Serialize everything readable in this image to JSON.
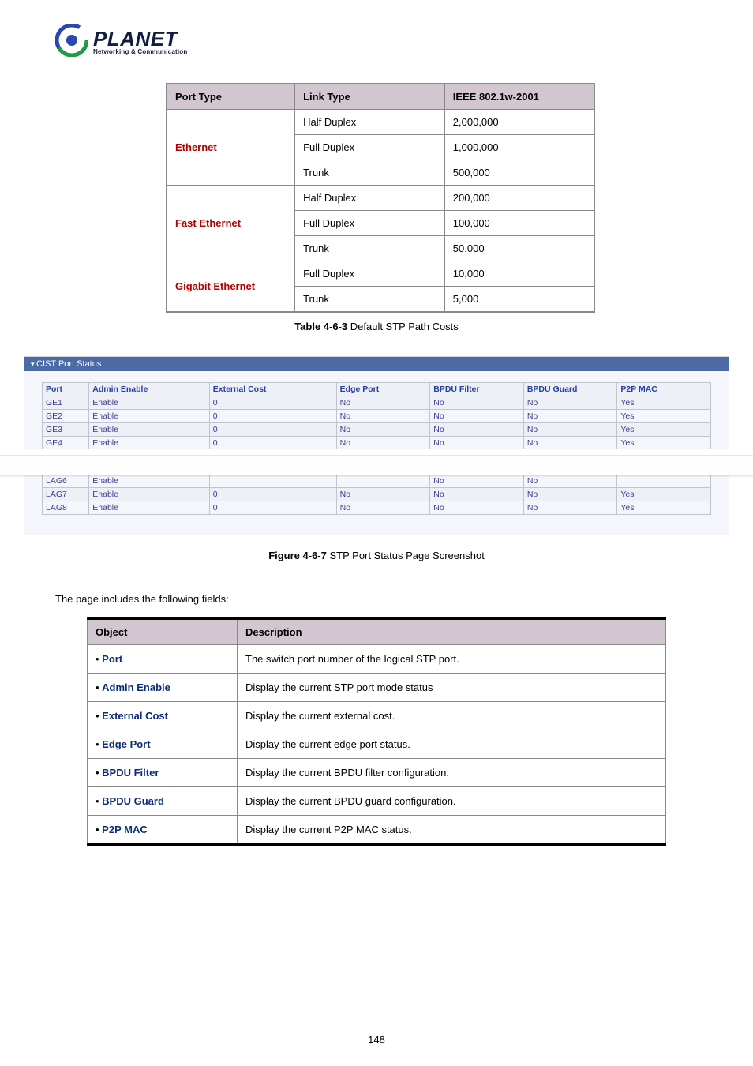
{
  "logo": {
    "brand": "PLANET",
    "tagline": "Networking & Communication"
  },
  "pathCost": {
    "headers": [
      "Port Type",
      "Link Type",
      "IEEE 802.1w-2001"
    ],
    "groups": [
      {
        "name": "Ethernet",
        "rows": [
          {
            "link": "Half Duplex",
            "cost": "2,000,000"
          },
          {
            "link": "Full Duplex",
            "cost": "1,000,000"
          },
          {
            "link": "Trunk",
            "cost": "500,000"
          }
        ]
      },
      {
        "name": "Fast Ethernet",
        "rows": [
          {
            "link": "Half Duplex",
            "cost": "200,000"
          },
          {
            "link": "Full Duplex",
            "cost": "100,000"
          },
          {
            "link": "Trunk",
            "cost": "50,000"
          }
        ]
      },
      {
        "name": "Gigabit Ethernet",
        "rows": [
          {
            "link": "Full Duplex",
            "cost": "10,000"
          },
          {
            "link": "Trunk",
            "cost": "5,000"
          }
        ]
      }
    ],
    "caption_bold": "Table 4-6-3",
    "caption_rest": " Default STP Path Costs"
  },
  "cist": {
    "title": "CIST Port Status",
    "headers": [
      "Port",
      "Admin Enable",
      "External Cost",
      "Edge Port",
      "BPDU Filter",
      "BPDU Guard",
      "P2P MAC"
    ],
    "top_rows": [
      {
        "c": [
          "GE1",
          "Enable",
          "0",
          "No",
          "No",
          "No",
          "Yes"
        ]
      },
      {
        "c": [
          "GE2",
          "Enable",
          "0",
          "No",
          "No",
          "No",
          "Yes"
        ]
      },
      {
        "c": [
          "GE3",
          "Enable",
          "0",
          "No",
          "No",
          "No",
          "Yes"
        ]
      },
      {
        "c": [
          "GE4",
          "Enable",
          "0",
          "No",
          "No",
          "No",
          "Yes"
        ]
      }
    ],
    "bottom_rows": [
      {
        "c": [
          "LAG6",
          "Enable",
          "",
          "",
          "No",
          "No",
          ""
        ]
      },
      {
        "c": [
          "LAG7",
          "Enable",
          "0",
          "No",
          "No",
          "No",
          "Yes"
        ]
      },
      {
        "c": [
          "LAG8",
          "Enable",
          "0",
          "No",
          "No",
          "No",
          "Yes"
        ]
      }
    ],
    "caption_bold": "Figure 4-6-7",
    "caption_rest": " STP Port Status Page Screenshot"
  },
  "intro": "The page includes the following fields:",
  "objects": {
    "headers": [
      "Object",
      "Description"
    ],
    "rows": [
      {
        "name": "Port",
        "desc": "The switch port number of the logical STP port."
      },
      {
        "name": "Admin Enable",
        "desc": "Display the current STP port mode status"
      },
      {
        "name": "External Cost",
        "desc": "Display the current external cost."
      },
      {
        "name": "Edge Port",
        "desc": "Display the current edge port status."
      },
      {
        "name": "BPDU Filter",
        "desc": "Display the current BPDU filter configuration."
      },
      {
        "name": "BPDU Guard",
        "desc": "Display the current BPDU guard configuration."
      },
      {
        "name": "P2P MAC",
        "desc": "Display the current P2P MAC status."
      }
    ]
  },
  "page_number": "148"
}
